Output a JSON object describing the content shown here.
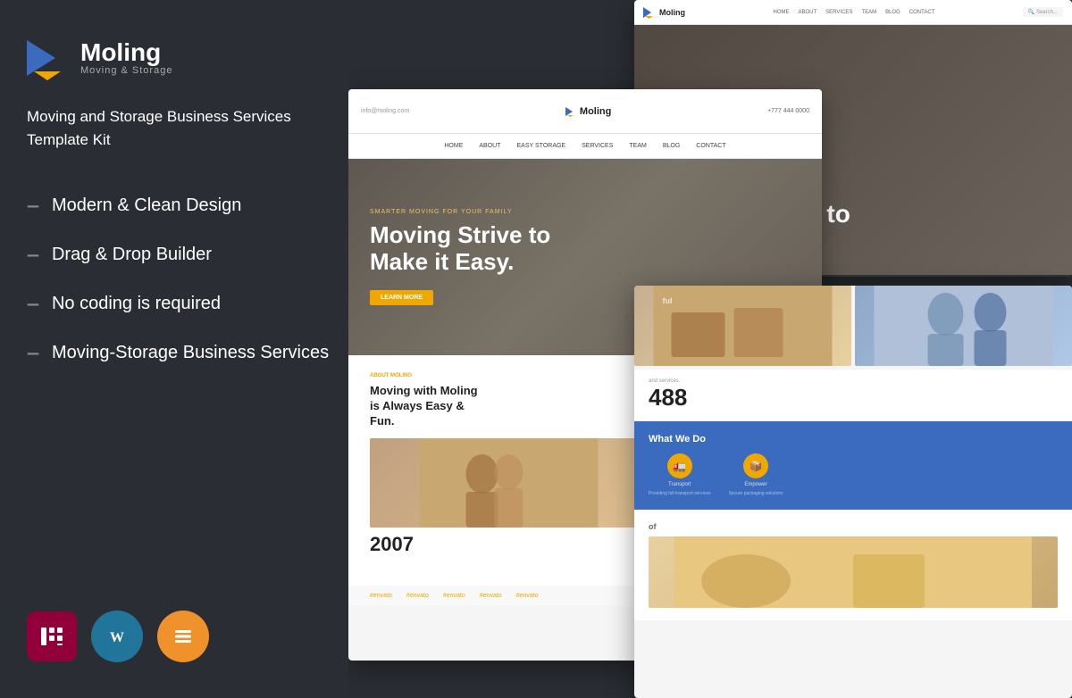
{
  "brand": {
    "name": "Moling",
    "tagline": "Moving & Storage"
  },
  "left": {
    "template_title": "Moving and Storage Business Services Template Kit",
    "features": [
      {
        "id": "modern-design",
        "label": "Modern & Clean Design"
      },
      {
        "id": "drag-drop",
        "label": "Drag & Drop Builder"
      },
      {
        "id": "no-coding",
        "label": "No coding is required"
      },
      {
        "id": "business-services",
        "label": "Moving-Storage Business Services"
      }
    ],
    "badges": [
      {
        "id": "elementor",
        "label": "Elementor"
      },
      {
        "id": "wordpress",
        "label": "WordPress"
      },
      {
        "id": "stackable",
        "label": "Stackable"
      }
    ]
  },
  "screenshots": {
    "main": {
      "header_left": "info@moling.com",
      "header_right": "+777 444 0000",
      "logo": "Moling",
      "nav_items": [
        "HOME",
        "ABOUT",
        "EASY STORAGE",
        "SERVICES",
        "TEAM",
        "BLOG",
        "CONTACT"
      ],
      "hero_sub": "SMARTER MOVING FOR YOUR FAMILY",
      "hero_title": "Moving Strive to\nMake it Easy.",
      "hero_btn": "LEARN MORE",
      "content_tag": "ABOUT MOLING",
      "content_title": "Moving with Moling\nis Always Easy &\nFun.",
      "year": "2007",
      "footer_tags": [
        "#envato",
        "#envato",
        "#envato",
        "#envato",
        "#envato"
      ]
    },
    "top_right": {
      "logo": "Moling",
      "nav_items": [
        "HOME",
        "ABOUT",
        "SERVICES",
        "TEAM",
        "BLOG",
        "CONTACT"
      ],
      "hero_title": "Moving Strive to\nMake it Easy.",
      "search_placeholder": "Search..."
    },
    "bottom_right": {
      "success_label": "ful",
      "number": "488",
      "services_text": "and services.",
      "blue_section_title": "What We Do",
      "icon1_label": "Transport",
      "icon2_label": "Empower",
      "bottom_label": "of"
    }
  },
  "colors": {
    "background": "#2a2d33",
    "accent_orange": "#f0a800",
    "accent_blue": "#3a6bbf",
    "elementor_red": "#92003b",
    "wp_blue": "#21759b",
    "text_white": "#ffffff",
    "text_gray": "#aaaaaa"
  }
}
